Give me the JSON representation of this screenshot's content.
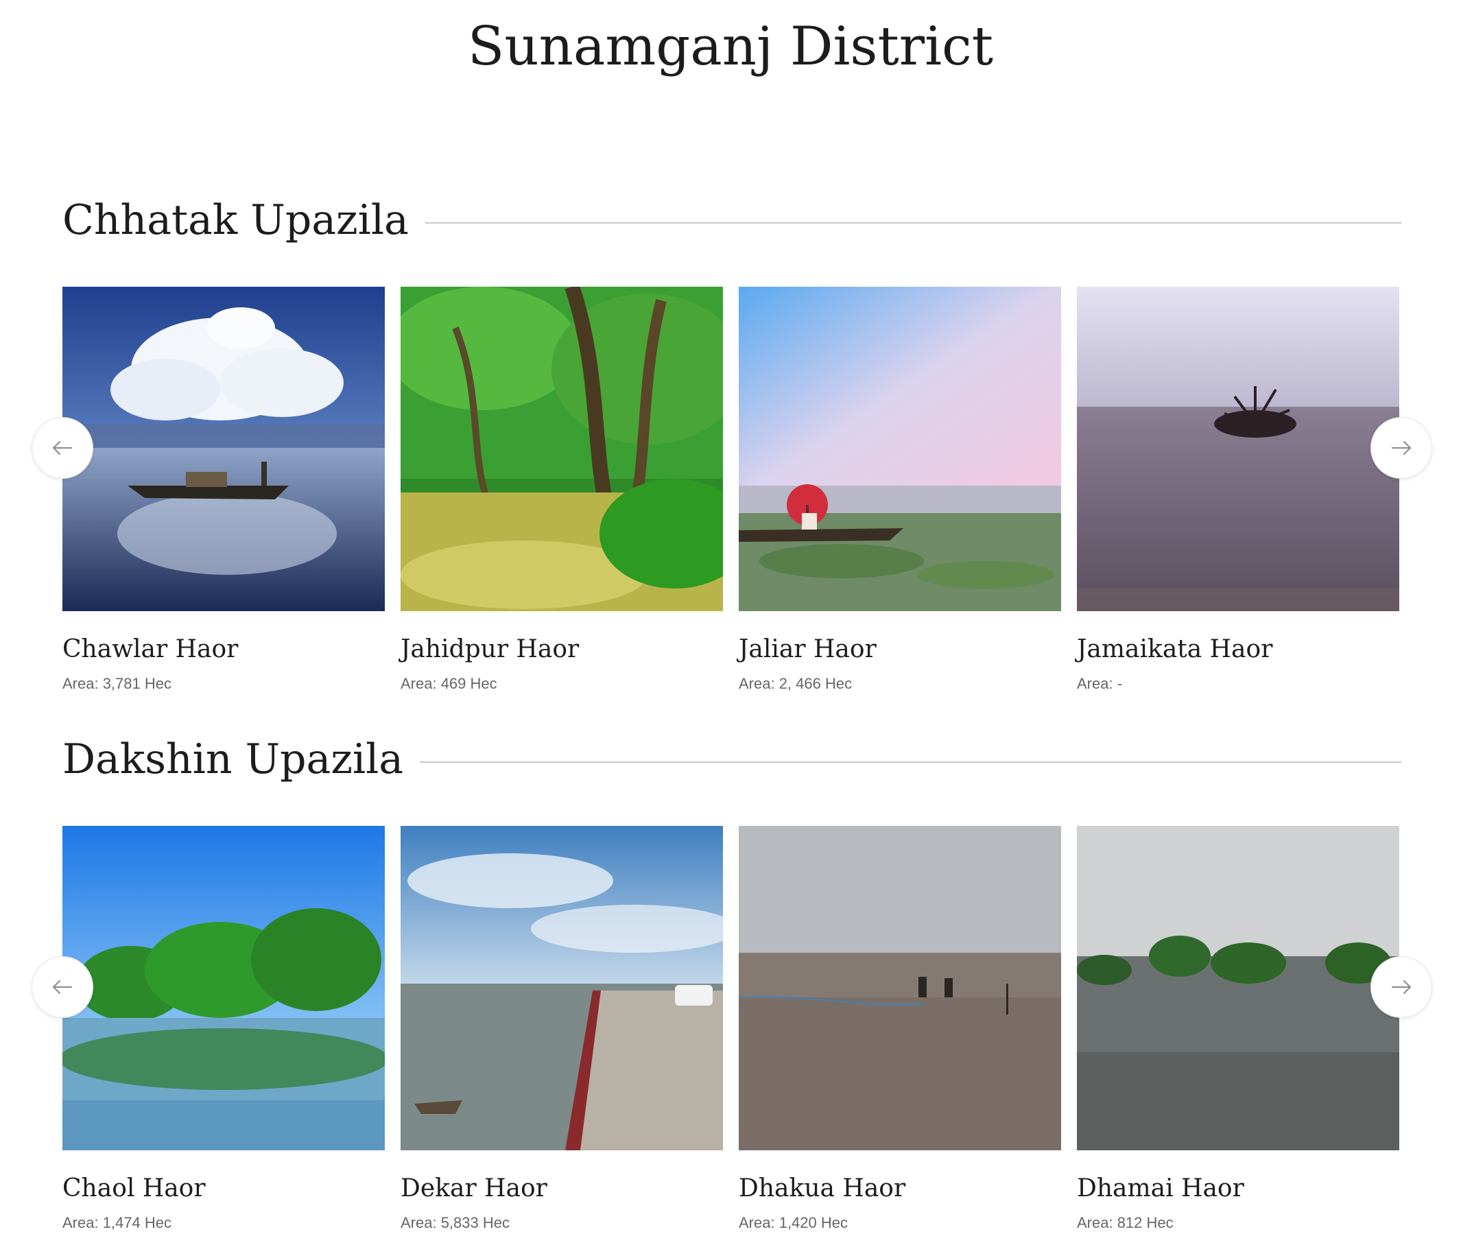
{
  "page_title": "Sunamganj District",
  "sections": [
    {
      "title": "Chhatak Upazila",
      "cards": [
        {
          "name": "Chawlar Haor",
          "area": "Area: 3,781 Hec"
        },
        {
          "name": "Jahidpur Haor",
          "area": "Area: 469 Hec"
        },
        {
          "name": "Jaliar Haor",
          "area": "Area: 2, 466 Hec"
        },
        {
          "name": "Jamaikata Haor",
          "area": "Area: -"
        }
      ]
    },
    {
      "title": "Dakshin Upazila",
      "cards": [
        {
          "name": "Chaol Haor",
          "area": "Area: 1,474 Hec"
        },
        {
          "name": "Dekar Haor",
          "area": "Area: 5,833 Hec"
        },
        {
          "name": "Dhakua Haor",
          "area": "Area: 1,420 Hec"
        },
        {
          "name": "Dhamai Haor",
          "area": "Area: 812 Hec"
        }
      ]
    }
  ],
  "icons": {
    "prev": "arrow-left-icon",
    "next": "arrow-right-icon"
  },
  "colors": {
    "text": "#1c1c1c",
    "muted": "#666666",
    "rule": "#c9c9c9"
  }
}
